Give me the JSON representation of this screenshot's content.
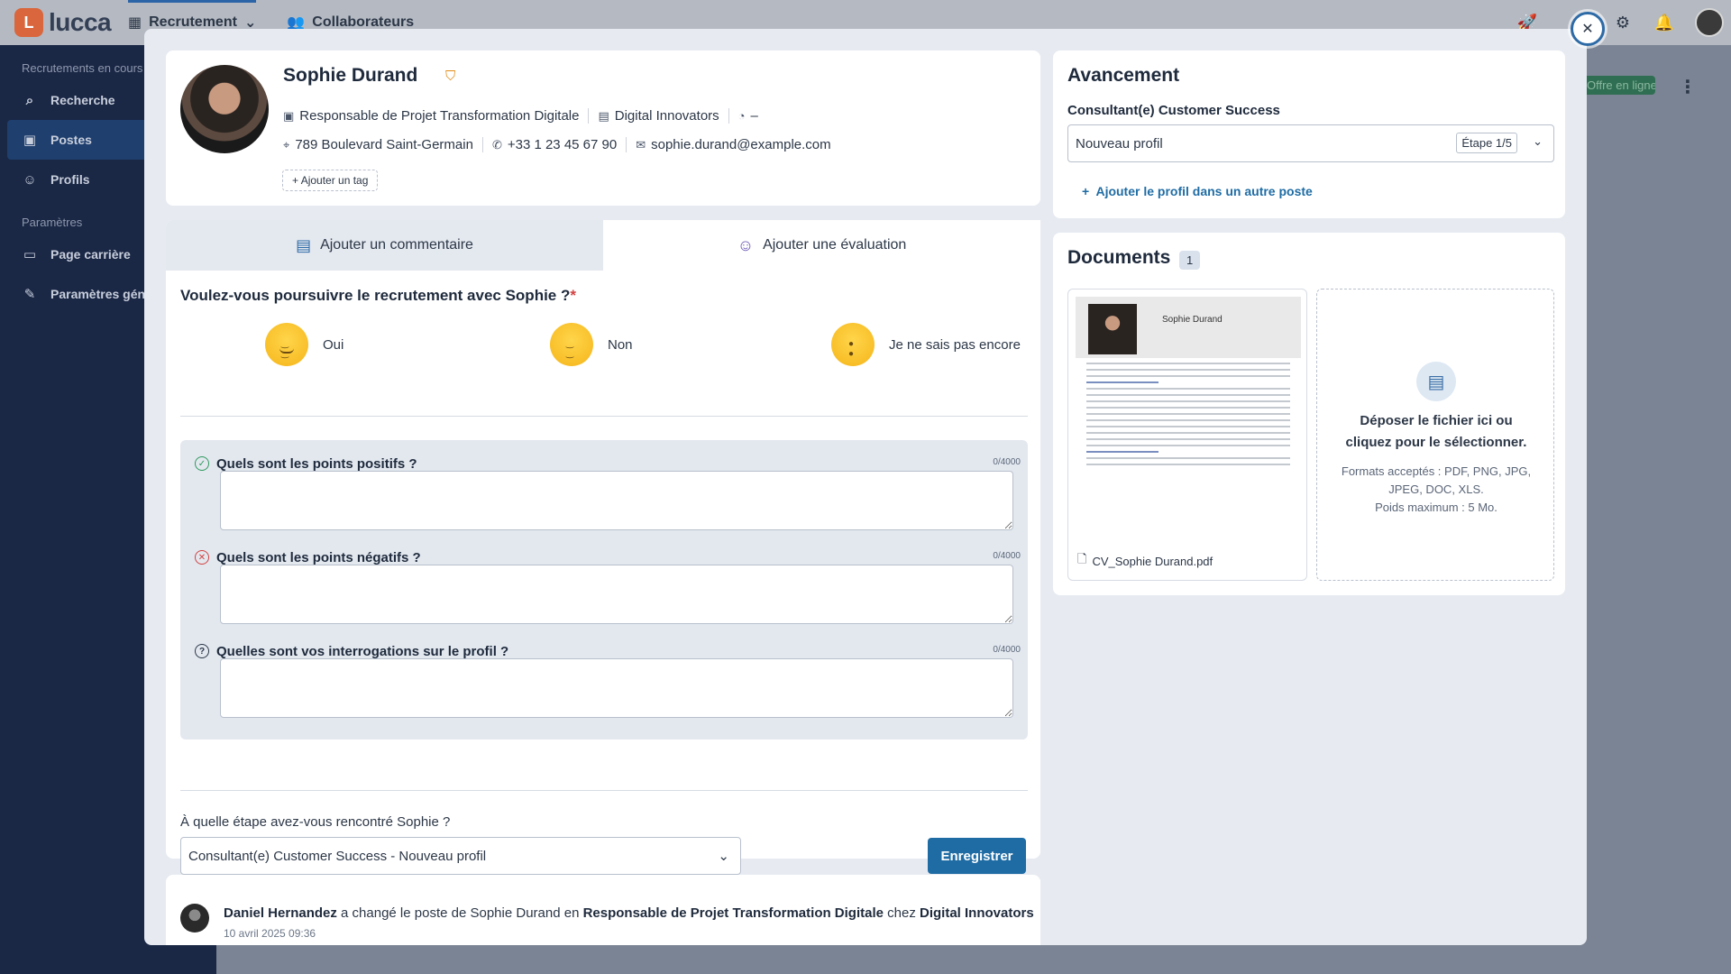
{
  "app": {
    "logo": "lucca",
    "nav": [
      {
        "label": "Recrutement"
      },
      {
        "label": "Collaborateurs"
      }
    ]
  },
  "sidebar": {
    "section1": "Recrutements en cours",
    "items1": [
      {
        "label": "Recherche"
      },
      {
        "label": "Postes"
      },
      {
        "label": "Profils"
      }
    ],
    "section2": "Paramètres",
    "items2": [
      {
        "label": "Page carrière"
      },
      {
        "label": "Paramètres généraux"
      }
    ]
  },
  "background": {
    "badge": "Offre en ligne"
  },
  "profile": {
    "name": "Sophie Durand",
    "job": "Responsable de Projet Transformation Digitale",
    "company": "Digital Innovators",
    "salary": "–",
    "address": "789 Boulevard Saint-Germain",
    "phone": "+33 1 23 45 67 90",
    "email": "sophie.durand@example.com",
    "tag_button": "Ajouter un tag"
  },
  "evaluation": {
    "tabs": [
      {
        "label": "Ajouter un commentaire"
      },
      {
        "label": "Ajouter une évaluation"
      }
    ],
    "question": "Voulez-vous poursuivre le recrutement avec Sophie ?",
    "required_mark": "*",
    "choices": [
      {
        "label": "Oui"
      },
      {
        "label": "Non"
      },
      {
        "label": "Je ne sais pas encore"
      }
    ],
    "fields": [
      {
        "label": "Quels sont les points positifs ?",
        "count": "0/4000",
        "value": ""
      },
      {
        "label": "Quels sont les points négatifs ?",
        "count": "0/4000",
        "value": ""
      },
      {
        "label": "Quelles sont vos interrogations sur le profil ?",
        "count": "0/4000",
        "value": ""
      }
    ],
    "stage_label": "À quelle étape avez-vous rencontré Sophie ?",
    "stage_value": "Consultant(e) Customer Success  - Nouveau profil",
    "save_label": "Enregistrer"
  },
  "history": {
    "author": "Daniel Hernandez",
    "text1": " a changé le poste de Sophie Durand en ",
    "job": "Responsable de Projet Transformation Digitale",
    "text2": " chez ",
    "company": "Digital Innovators",
    "date": "10 avril 2025 09:36"
  },
  "progress": {
    "title": "Avancement",
    "position": "Consultant(e) Customer Success",
    "status": "Nouveau profil",
    "step": "Étape 1/5",
    "add_link": "Ajouter le profil dans un autre poste"
  },
  "documents": {
    "title": "Documents",
    "count": "1",
    "file_name": "CV_Sophie Durand.pdf",
    "preview_name": "Sophie Durand",
    "drop_title": "Déposer le fichier ici ou cliquez pour le sélectionner.",
    "formats": "Formats acceptés : PDF, PNG, JPG, JPEG, DOC, XLS.",
    "max_size": "Poids maximum : 5 Mo."
  }
}
